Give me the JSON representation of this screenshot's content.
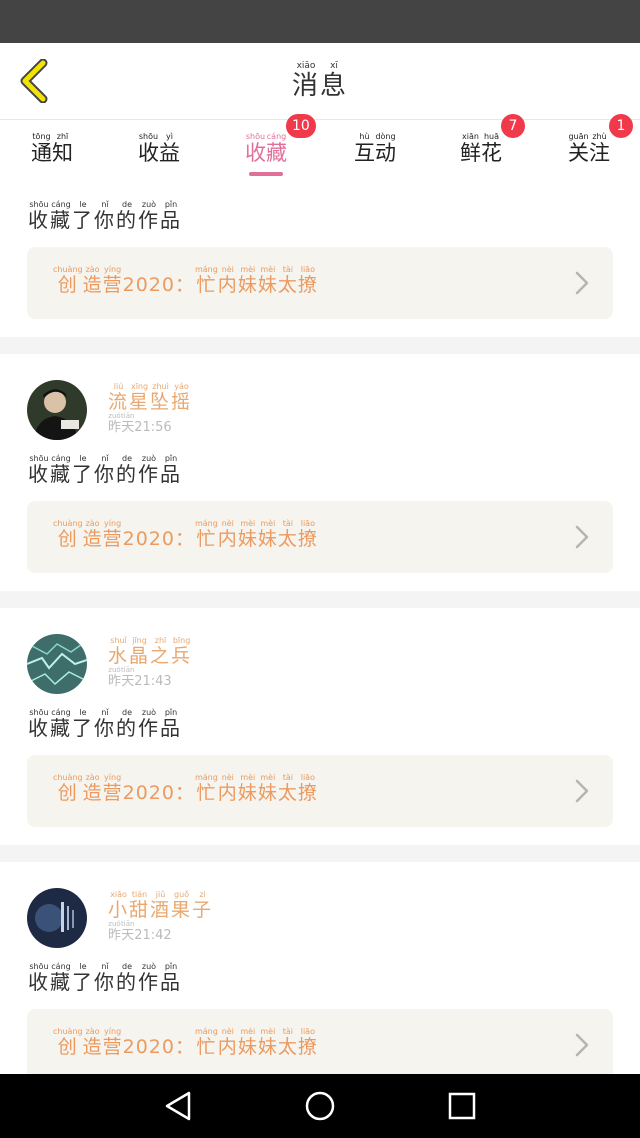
{
  "header": {
    "title": [
      {
        "c": "消",
        "p": "xiāo"
      },
      {
        "c": "息",
        "p": "xī"
      }
    ]
  },
  "tabs": [
    {
      "chars": [
        {
          "c": "通",
          "p": "tōng"
        },
        {
          "c": "知",
          "p": "zhī"
        }
      ],
      "badge": ""
    },
    {
      "chars": [
        {
          "c": "收",
          "p": "shōu"
        },
        {
          "c": "益",
          "p": "yì"
        }
      ],
      "badge": ""
    },
    {
      "chars": [
        {
          "c": "收",
          "p": "shōu"
        },
        {
          "c": "藏",
          "p": "cáng"
        }
      ],
      "badge": "10",
      "active": true
    },
    {
      "chars": [
        {
          "c": "互",
          "p": "hù"
        },
        {
          "c": "动",
          "p": "dòng"
        }
      ],
      "badge": ""
    },
    {
      "chars": [
        {
          "c": "鲜",
          "p": "xiān"
        },
        {
          "c": "花",
          "p": "huā"
        }
      ],
      "badge": "7"
    },
    {
      "chars": [
        {
          "c": "关",
          "p": "guān"
        },
        {
          "c": "注",
          "p": "zhù"
        }
      ],
      "badge": "1"
    }
  ],
  "action_text": [
    {
      "c": "收",
      "p": "shōu"
    },
    {
      "c": "藏",
      "p": "cáng"
    },
    {
      "c": "了",
      "p": "le"
    },
    {
      "c": "你",
      "p": "nǐ"
    },
    {
      "c": "的",
      "p": "de"
    },
    {
      "c": "作",
      "p": "zuò"
    },
    {
      "c": "品",
      "p": "pǐn"
    }
  ],
  "work_title": [
    {
      "c": "创",
      "p": "chuàng"
    },
    {
      "c": "造",
      "p": "zào"
    },
    {
      "c": "营",
      "p": "yíng"
    },
    {
      "c": "2020：",
      "p": ""
    },
    {
      "c": "忙",
      "p": "máng"
    },
    {
      "c": "内",
      "p": "nèi"
    },
    {
      "c": "妹",
      "p": "mèi"
    },
    {
      "c": "妹",
      "p": "mèi"
    },
    {
      "c": "太",
      "p": "tài"
    },
    {
      "c": "撩",
      "p": "liāo"
    }
  ],
  "items": [
    {
      "user": null,
      "time": ""
    },
    {
      "user": [
        {
          "c": "流",
          "p": "liú"
        },
        {
          "c": "星",
          "p": "xīng"
        },
        {
          "c": "坠",
          "p": "zhuì"
        },
        {
          "c": "摇",
          "p": "yáo"
        }
      ],
      "time_word": [
        {
          "c": "昨",
          "p": "zuó"
        },
        {
          "c": "天",
          "p": "tiān"
        }
      ],
      "time": "21:56",
      "avatar": "dark"
    },
    {
      "user": [
        {
          "c": "水",
          "p": "shuǐ"
        },
        {
          "c": "晶",
          "p": "jīng"
        },
        {
          "c": "之",
          "p": "zhī"
        },
        {
          "c": "兵",
          "p": "bīng"
        }
      ],
      "time_word": [
        {
          "c": "昨",
          "p": "zuó"
        },
        {
          "c": "天",
          "p": "tiān"
        }
      ],
      "time": "21:43",
      "avatar": "teal"
    },
    {
      "user": [
        {
          "c": "小",
          "p": "xiǎo"
        },
        {
          "c": "甜",
          "p": "tián"
        },
        {
          "c": "酒",
          "p": "jiǔ"
        },
        {
          "c": "果",
          "p": "guǒ"
        },
        {
          "c": "子",
          "p": "zi"
        }
      ],
      "time_word": [
        {
          "c": "昨",
          "p": "zuó"
        },
        {
          "c": "天",
          "p": "tiān"
        }
      ],
      "time": "21:42",
      "avatar": "navy"
    }
  ],
  "colors": {
    "accent": "#e0709a",
    "badge": "#f0394a",
    "username": "#e8a870",
    "work_text": "#ec9a60",
    "work_bg": "#f5f4ee",
    "back_icon": "#f2e400"
  }
}
